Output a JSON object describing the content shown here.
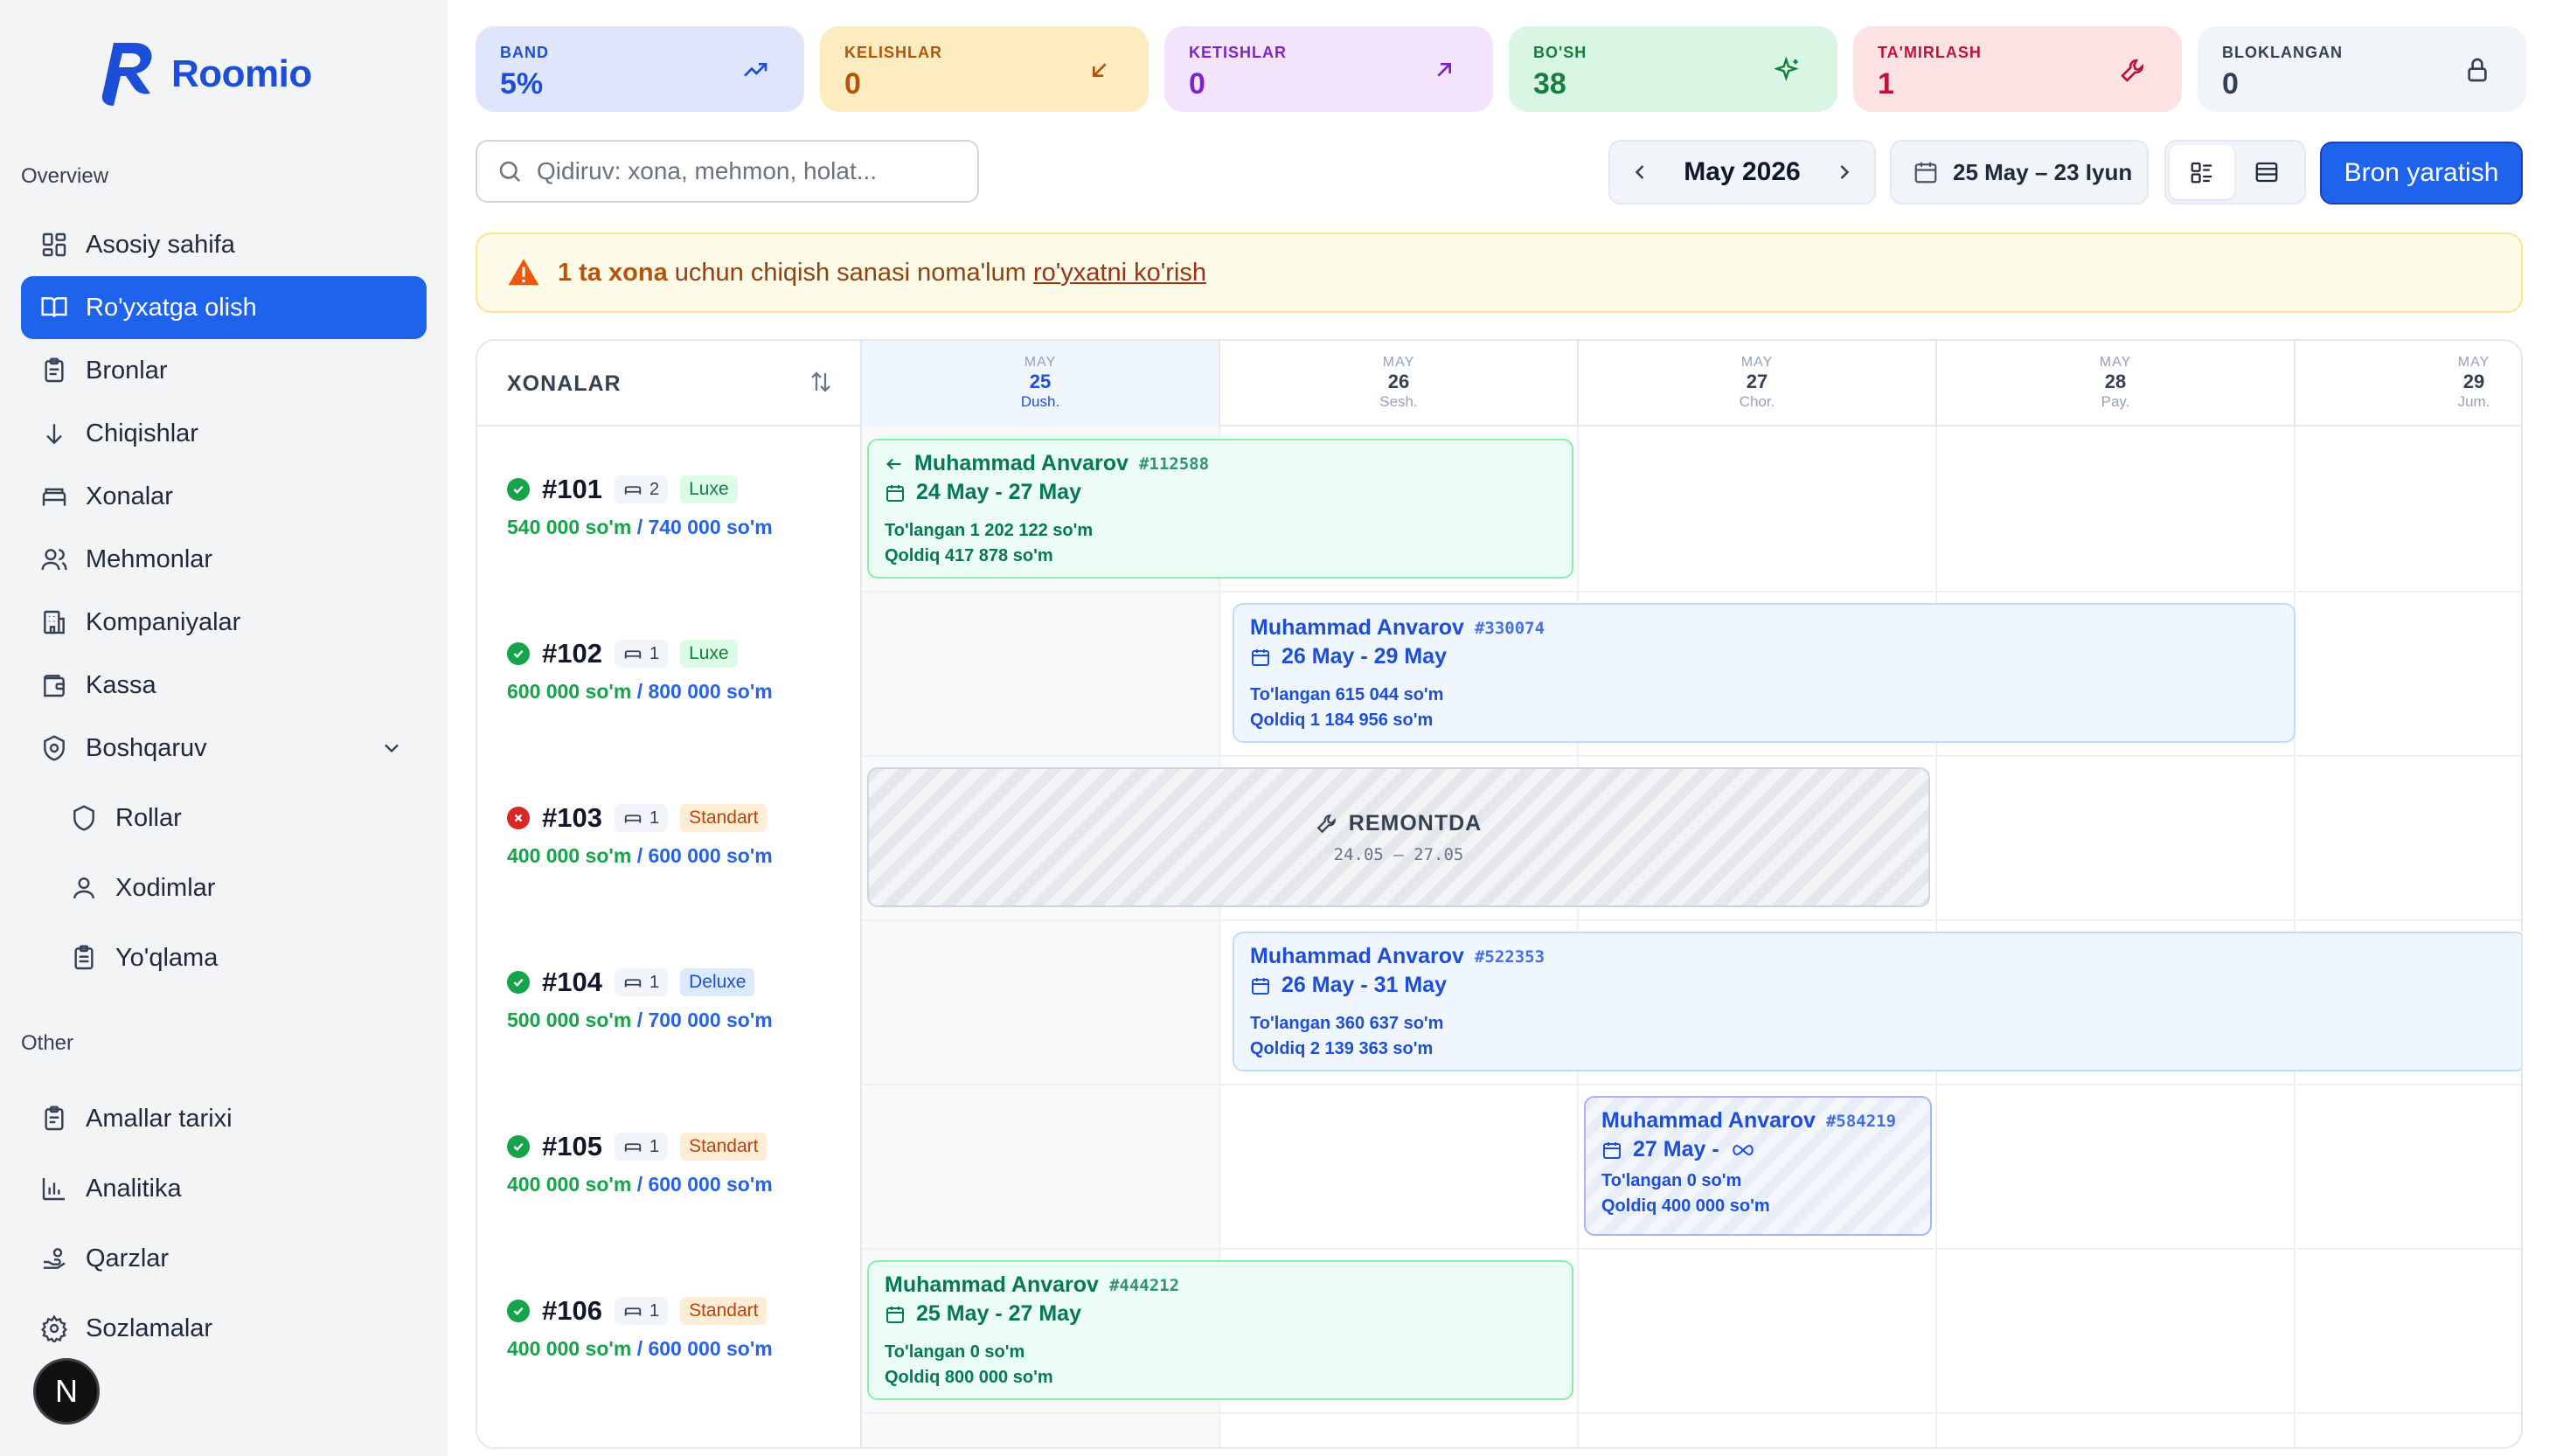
{
  "app": {
    "name": "Roomio"
  },
  "sidebar": {
    "overview_label": "Overview",
    "other_label": "Other",
    "items": [
      {
        "label": "Asosiy sahifa",
        "icon": "dashboard-icon"
      },
      {
        "label": "Ro'yxatga olish",
        "icon": "book-open-icon",
        "active": true
      },
      {
        "label": "Bronlar",
        "icon": "clipboard-icon"
      },
      {
        "label": "Chiqishlar",
        "icon": "arrow-down-icon"
      },
      {
        "label": "Xonalar",
        "icon": "bed-icon"
      },
      {
        "label": "Mehmonlar",
        "icon": "users-icon"
      },
      {
        "label": "Kompaniyalar",
        "icon": "building-icon"
      },
      {
        "label": "Kassa",
        "icon": "wallet-icon"
      },
      {
        "label": "Boshqaruv",
        "icon": "shield-gear-icon"
      }
    ],
    "sub_items": [
      {
        "label": "Rollar",
        "icon": "shield-icon"
      },
      {
        "label": "Xodimlar",
        "icon": "user-icon"
      },
      {
        "label": "Yo'qlama",
        "icon": "clipboard-check-icon"
      }
    ],
    "other_items": [
      {
        "label": "Amallar tarixi",
        "icon": "history-icon"
      },
      {
        "label": "Analitika",
        "icon": "bar-chart-icon"
      },
      {
        "label": "Qarzlar",
        "icon": "hand-coins-icon"
      },
      {
        "label": "Sozlamalar",
        "icon": "gear-icon"
      }
    ],
    "avatar_letter": "N"
  },
  "stats": [
    {
      "label": "BAND",
      "value": "5%",
      "icon": "trending-up-icon",
      "bg": "#dfe6fb",
      "fg": "#1d4ed8"
    },
    {
      "label": "KELISHLAR",
      "value": "0",
      "icon": "arrow-down-left-icon",
      "bg": "#fdecc0",
      "fg": "#b45309"
    },
    {
      "label": "KETISHLAR",
      "value": "0",
      "icon": "arrow-up-right-icon",
      "bg": "#f3e3fb",
      "fg": "#7e22ce"
    },
    {
      "label": "BO'SH",
      "value": "38",
      "icon": "sparkles-icon",
      "bg": "#d9f5e3",
      "fg": "#15803d"
    },
    {
      "label": "TA'MIRLASH",
      "value": "1",
      "icon": "wrench-icon",
      "bg": "#fde2e4",
      "fg": "#be123c"
    },
    {
      "label": "BLOKLANGAN",
      "value": "0",
      "icon": "lock-icon",
      "bg": "#f1f5f9",
      "fg": "#334155"
    }
  ],
  "toolbar": {
    "search_placeholder": "Qidiruv: xona, mehmon, holat...",
    "month": "May 2026",
    "date_range": "25 May – 23 Iyun",
    "create_button": "Bron yaratish"
  },
  "alert": {
    "strong": "1 ta xona",
    "text": "uchun chiqish sanasi noma'lum",
    "link": "ro'yxatni ko'rish"
  },
  "timeline": {
    "rooms_header": "XONALAR",
    "days": [
      {
        "month": "MAY",
        "day": "25",
        "dow": "Dush.",
        "today": true
      },
      {
        "month": "MAY",
        "day": "26",
        "dow": "Sesh."
      },
      {
        "month": "MAY",
        "day": "27",
        "dow": "Chor."
      },
      {
        "month": "MAY",
        "day": "28",
        "dow": "Pay."
      },
      {
        "month": "MAY",
        "day": "29",
        "dow": "Jum."
      }
    ],
    "rooms": [
      {
        "number": "#101",
        "beds": "2",
        "type": "Luxe",
        "status": "ok",
        "price_paid": "540 000 so'm",
        "price_full": "/ 740 000 so'm"
      },
      {
        "number": "#102",
        "beds": "1",
        "type": "Luxe",
        "status": "ok",
        "price_paid": "600 000 so'm",
        "price_full": "/ 800 000 so'm"
      },
      {
        "number": "#103",
        "beds": "1",
        "type": "Standart",
        "status": "blocked",
        "price_paid": "400 000 so'm",
        "price_full": "/ 600 000 so'm"
      },
      {
        "number": "#104",
        "beds": "1",
        "type": "Deluxe",
        "status": "ok",
        "price_paid": "500 000 so'm",
        "price_full": "/ 700 000 so'm"
      },
      {
        "number": "#105",
        "beds": "1",
        "type": "Standart",
        "status": "ok",
        "price_paid": "400 000 so'm",
        "price_full": "/ 600 000 so'm"
      },
      {
        "number": "#106",
        "beds": "1",
        "type": "Standart",
        "status": "ok",
        "price_paid": "400 000 so'm",
        "price_full": "/ 600 000 so'm"
      }
    ],
    "bookings": [
      {
        "name": "Muhammad Anvarov",
        "id": "#112588",
        "dates": "24 May - 27 May",
        "paid": "To'langan 1 202 122 so'm",
        "left": "Qoldiq 417 878 so'm"
      },
      {
        "name": "Muhammad Anvarov",
        "id": "#330074",
        "dates": "26 May - 29 May",
        "paid": "To'langan 615 044 so'm",
        "left": "Qoldiq 1 184 956 so'm"
      },
      {
        "name": "Muhammad Anvarov",
        "id": "#522353",
        "dates": "26 May - 31 May",
        "paid": "To'langan 360 637 so'm",
        "left": "Qoldiq 2 139 363 so'm"
      },
      {
        "name": "Muhammad Anvarov",
        "id": "#584219",
        "dates": "27 May -",
        "paid": "To'langan 0 so'm",
        "left": "Qoldiq 400 000 so'm"
      },
      {
        "name": "Muhammad Anvarov",
        "id": "#444212",
        "dates": "25 May - 27 May",
        "paid": "To'langan 0 so'm",
        "left": "Qoldiq 800 000 so'm"
      }
    ],
    "maintenance": {
      "title": "REMONTDA",
      "dates": "24.05 – 27.05"
    }
  }
}
